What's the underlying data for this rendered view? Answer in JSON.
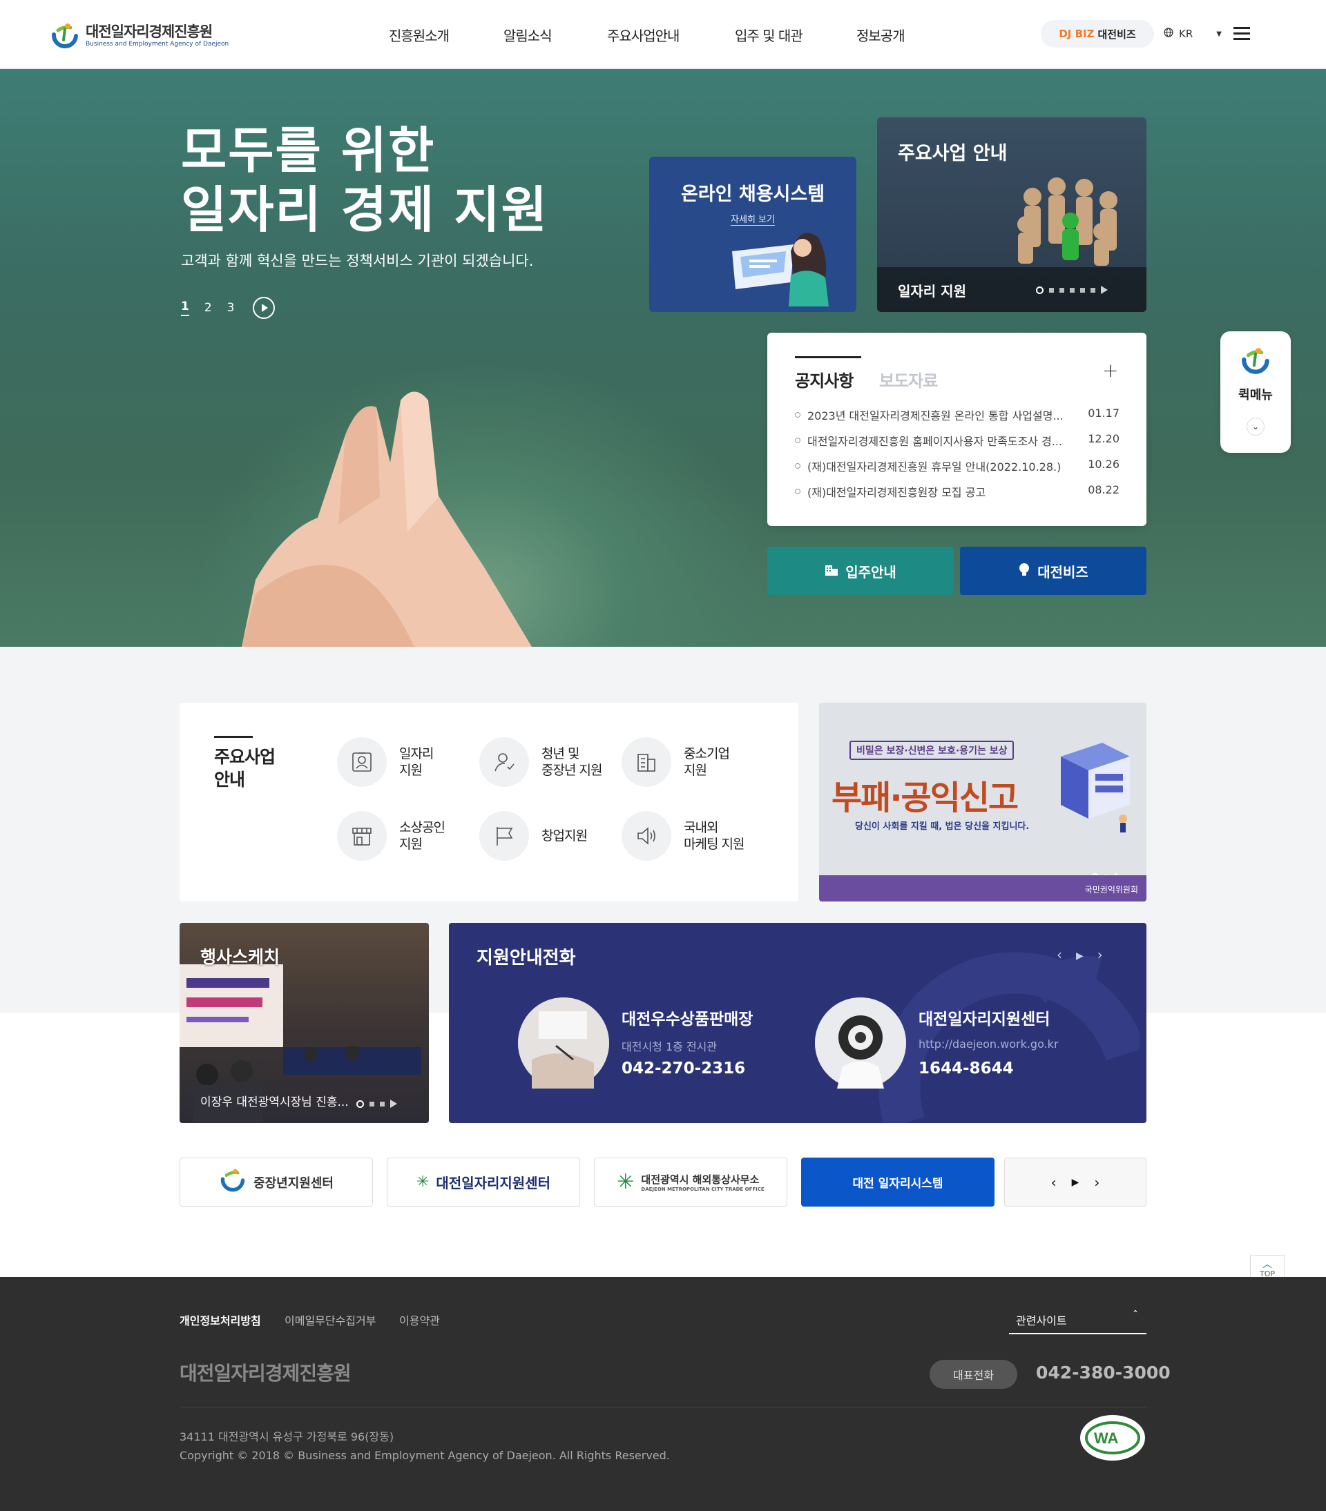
{
  "header": {
    "logo_ko": "대전일자리경제진흥원",
    "logo_en": "Business and Employment Agency of Daejeon",
    "nav": [
      "진흥원소개",
      "알림소식",
      "주요사업안내",
      "입주 및 대관",
      "정보공개"
    ],
    "biz_pill_dj": "DJ BIZ",
    "biz_pill_label": "대전비즈",
    "lang": "KR"
  },
  "hero": {
    "title_line1": "모두를 위한",
    "title_line2": "일자리 경제 지원",
    "subtitle": "고객과 함께 혁신을 만드는 정책서비스 기관이 되겠습니다.",
    "pager": [
      "1",
      "2",
      "3"
    ]
  },
  "recruit_card": {
    "title": "온라인 채용시스템",
    "link": "자세히 보기"
  },
  "biz_card": {
    "title": "주요사업 안내",
    "caption": "일자리 지원"
  },
  "notice": {
    "tab_active": "공지사항",
    "tab_inactive": "보도자료",
    "items": [
      {
        "title": "2023년 대전일자리경제진흥원 온라인 통합 사업설명...",
        "date": "01.17"
      },
      {
        "title": "대전일자리경제진흥원 홈페이지사용자 만족도조사 경...",
        "date": "12.20"
      },
      {
        "title": "(재)대전일자리경제진흥원 휴무일 안내(2022.10.28.)",
        "date": "10.26"
      },
      {
        "title": "(재)대전일자리경제진흥원장 모집 공고",
        "date": "08.22"
      }
    ]
  },
  "quick_buttons": {
    "move_in": "입주안내",
    "djbiz": "대전비즈"
  },
  "quick_menu": {
    "label": "퀵메뉴"
  },
  "biz_panel": {
    "title": "주요사업 안내",
    "items": [
      {
        "label": "일자리\n지원",
        "icon": "id-card-icon"
      },
      {
        "label": "청년 및\n중장년 지원",
        "icon": "person-icon"
      },
      {
        "label": "중소기업\n지원",
        "icon": "building-icon"
      },
      {
        "label": "소상공인\n지원",
        "icon": "shop-icon"
      },
      {
        "label": "창업지원",
        "icon": "flag-icon"
      },
      {
        "label": "국내외\n마케팅 지원",
        "icon": "speaker-icon"
      }
    ]
  },
  "banner": {
    "top": "비밀은 보장·신변은 보호·용기는 보상",
    "big": "부패·공익신고",
    "small": "당신이 사회를 지킬 때, 법은 당신을 지킵니다.",
    "org": "국민권익위원회"
  },
  "event": {
    "title": "행사스케치",
    "caption": "이장우 대전광역시장님 진흥..."
  },
  "phone": {
    "title": "지원안내전화",
    "cards": [
      {
        "name": "대전우수상품판매장",
        "sub": "대전시청 1층 전시관",
        "tel": "042-270-2316"
      },
      {
        "name": "대전일자리지원센터",
        "sub": "http://daejeon.work.go.kr",
        "tel": "1644-8644"
      }
    ]
  },
  "links": [
    "중장년지원센터",
    "대전일자리지원센터",
    "대전광역시 해외통상사무소",
    "대전 일자리시스템"
  ],
  "links_sub": "DAEJEON METROPOLITAN CITY TRADE OFFICE",
  "top_btn": "TOP",
  "footer": {
    "links": [
      "개인정보처리방침",
      "이메일무단수집거부",
      "이용약관"
    ],
    "related": "관련사이트",
    "org": "대전일자리경제진흥원",
    "tel_label": "대표전화",
    "tel": "042-380-3000",
    "address": "34111 대전광역시 유성구 가정북로 96(장동)",
    "copyright": "Copyright © 2018 © Business and Employment Agency of Daejeon. All Rights Reserved.",
    "wa": "WA"
  },
  "colors": {
    "teal": "#1d8a84",
    "navy": "#0e4a9a",
    "indigo": "#2b3276",
    "accent_orange": "#f07c2a"
  }
}
